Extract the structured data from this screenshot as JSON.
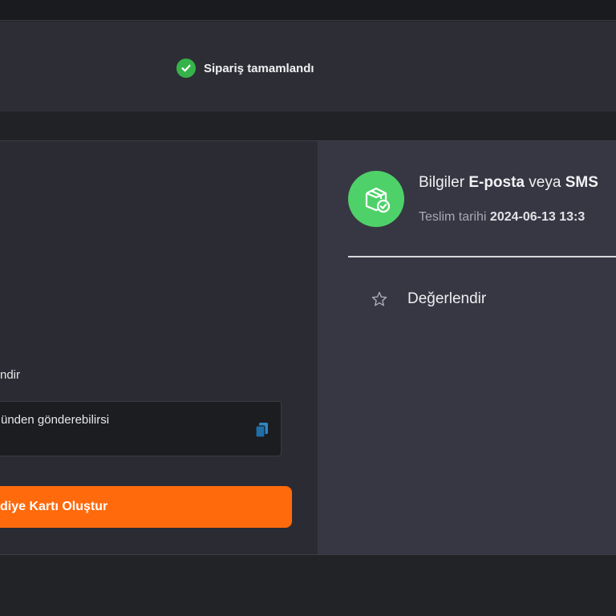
{
  "status": {
    "text": "Sipariş tamamlandı",
    "icon": "check-circle-icon",
    "color": "#35b34a"
  },
  "left_panel": {
    "section_label": "ndir",
    "message_text": "ünden gönderebilirsi",
    "copy_icon": "copy-icon",
    "button_label": "diye Kartı Oluştur",
    "button_color": "#ff6a0c"
  },
  "right_panel": {
    "icon": "delivery-box-check-icon",
    "icon_color": "#4fd169",
    "info": {
      "prefix": "Bilgiler",
      "email": "E-posta",
      "connector": "veya",
      "sms": "SMS"
    },
    "delivery": {
      "label": "Teslim tarihi",
      "datetime": "2024-06-13 13:3"
    },
    "rate_label": "Değerlendir",
    "rate_icon": "star-icon"
  }
}
